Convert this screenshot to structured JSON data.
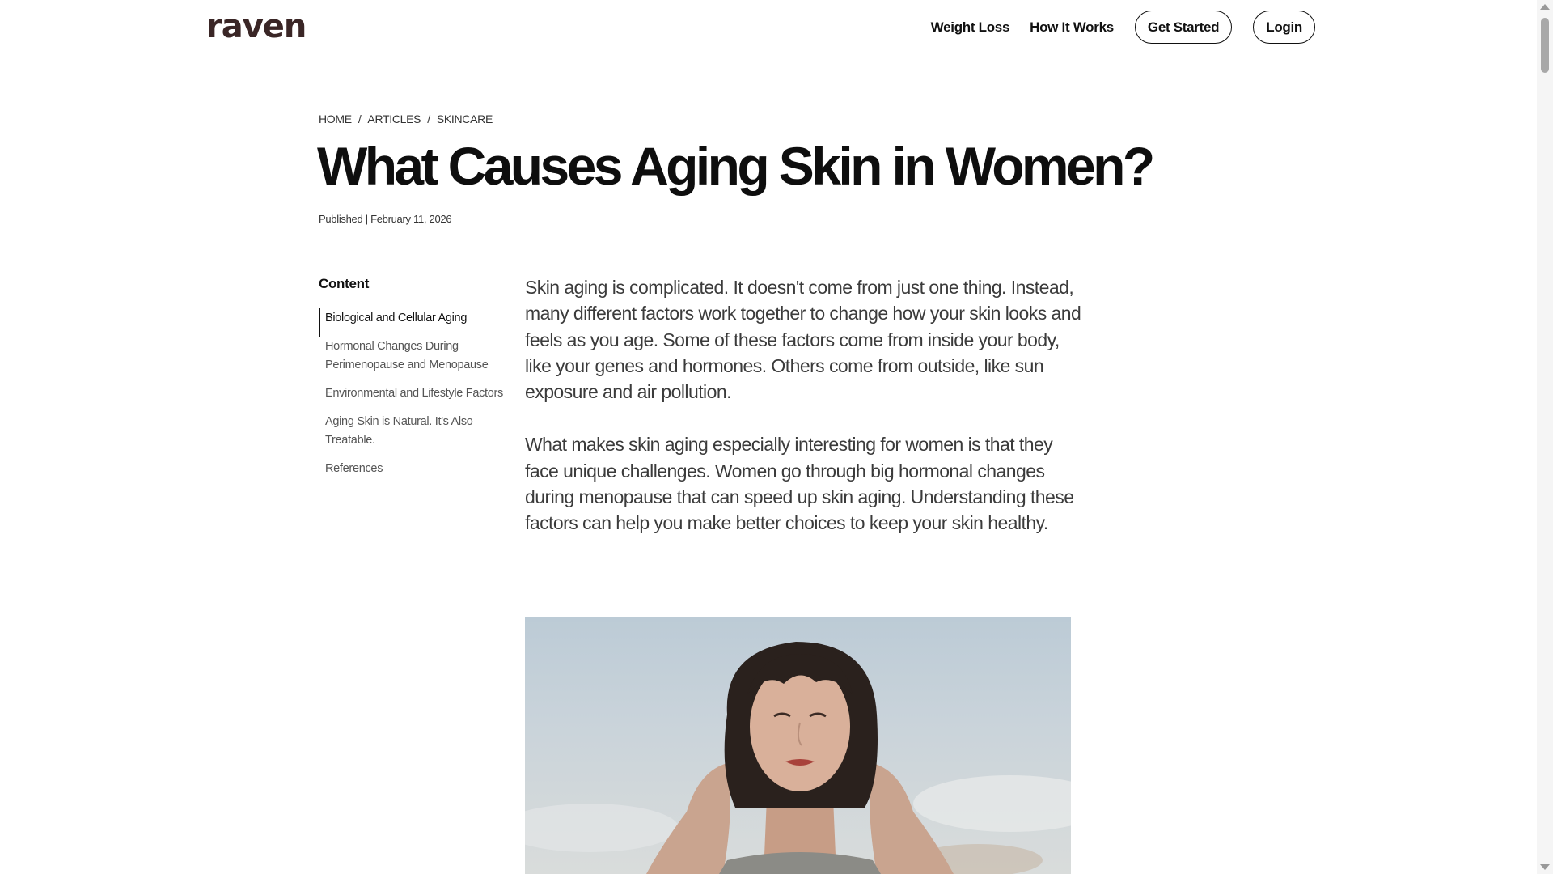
{
  "header": {
    "logo": "raven",
    "nav": {
      "weight_loss": "Weight Loss",
      "how_it_works": "How It Works",
      "get_started": "Get Started",
      "login": "Login"
    }
  },
  "breadcrumb": [
    "HOME",
    "ARTICLES",
    "SKINCARE"
  ],
  "breadcrumb_separator": "/",
  "article": {
    "title": "What Causes Aging Skin in Women?",
    "published": "Published | February 11, 2026",
    "paragraphs": [
      "Skin aging is complicated. It doesn't come from just one thing. Instead, many different factors work together to change how your skin looks and feels as you age. Some of these factors come from inside your body, like your genes and hormones. Others come from outside, like sun exposure and air pollution.",
      "What makes skin aging especially interesting for women is that they face unique challenges. Women go through big hormonal changes during menopause that can speed up skin aging. Understanding these factors can help you make better choices to keep your skin healthy."
    ]
  },
  "toc": {
    "heading": "Content",
    "active_index": 0,
    "items": [
      "Biological and Cellular Aging",
      "Hormonal Changes During Perimenopause and Menopause",
      "Environmental and Lifestyle Factors",
      "Aging Skin is Natural. It's Also Treatable.",
      "References"
    ]
  },
  "colors": {
    "logo": "#3a2626",
    "text": "#111111",
    "body_text": "#3b3b3b",
    "toc_border": "#d9d9d9"
  }
}
